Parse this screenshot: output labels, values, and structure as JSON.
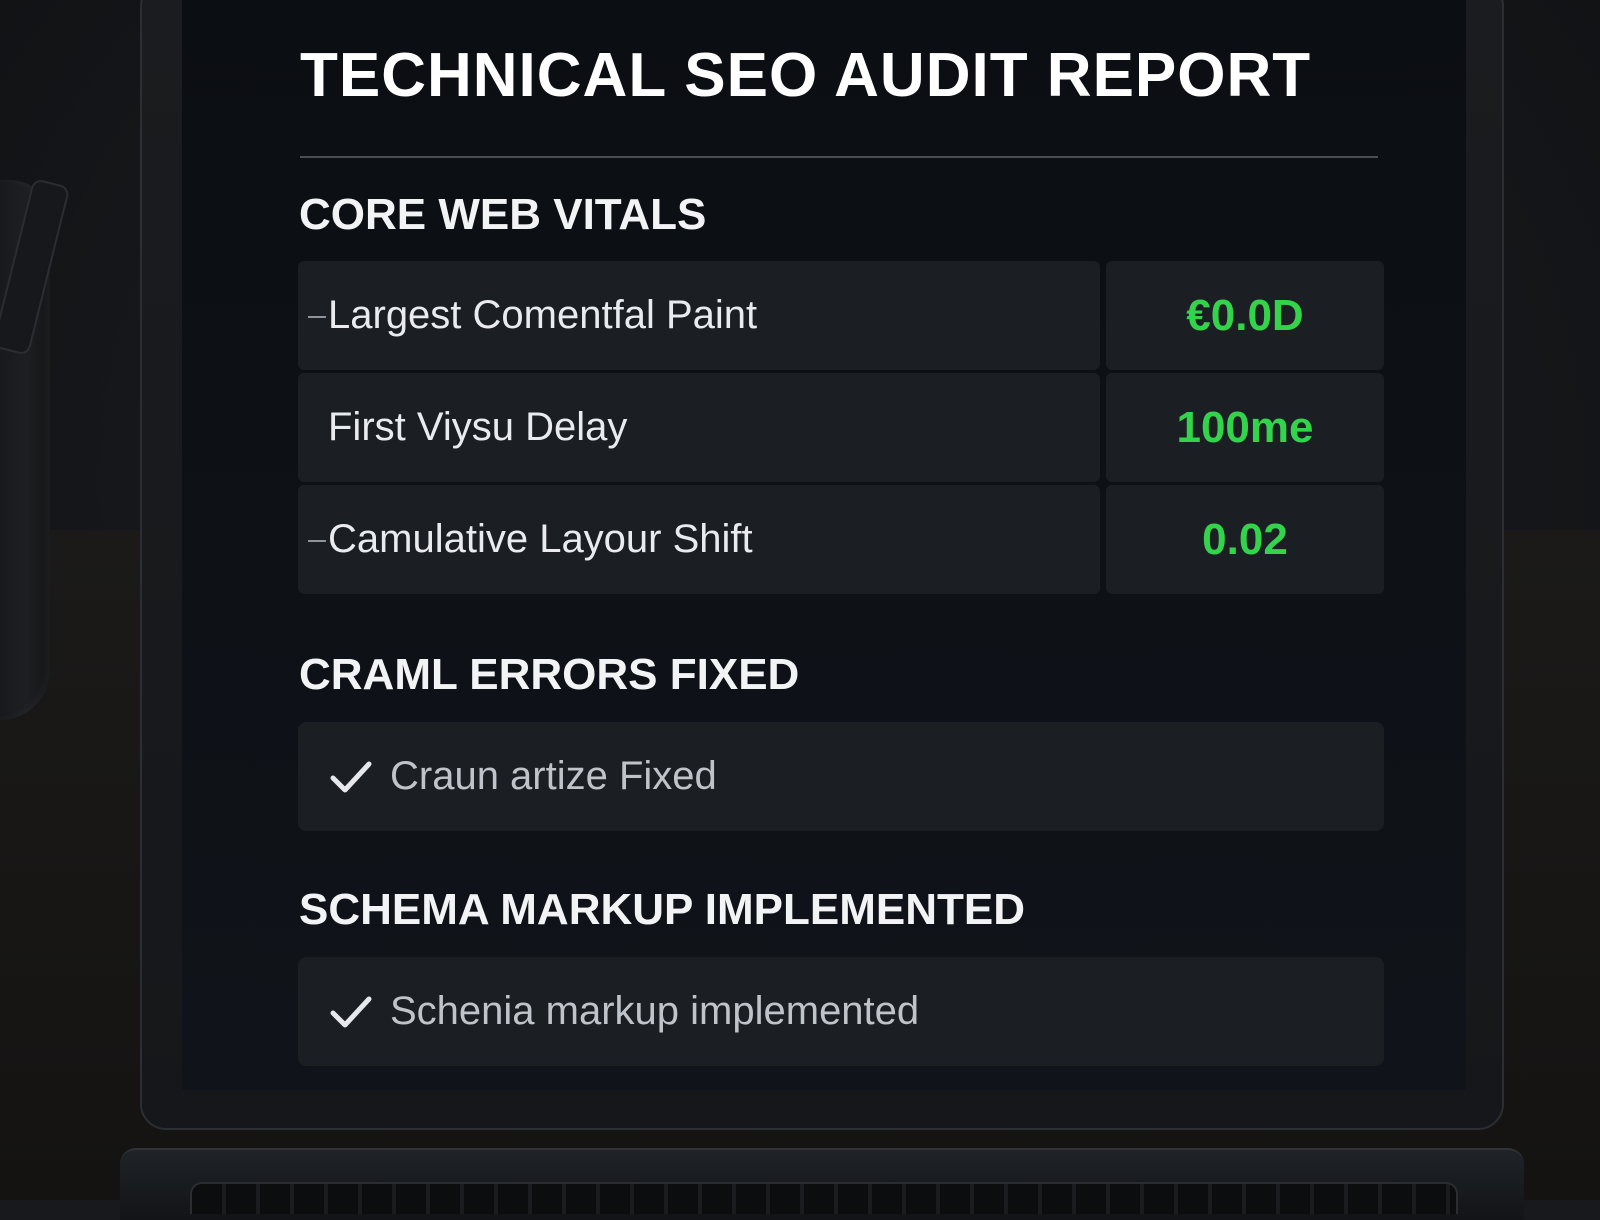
{
  "report": {
    "title": "TECHNICAL SEO AUDIT REPORT"
  },
  "core_web_vitals": {
    "heading": "CORE WEB VITALS",
    "rows": [
      {
        "metric": "Largest Comentfal Paint",
        "value": "€0.0D"
      },
      {
        "metric": "First Viysu Delay",
        "value": "100me"
      },
      {
        "metric": "Camulative Layour Shift",
        "value": "0.02"
      }
    ],
    "value_color": "#33d44b"
  },
  "crawl_errors": {
    "heading": "CRAML ERRORS FIXED",
    "item": "Craun artize Fixed",
    "icon": "check-icon"
  },
  "schema_markup": {
    "heading": "SCHEMA MARKUP IMPLEMENTED",
    "item": "Schenia markup implemented",
    "icon": "check-icon"
  }
}
